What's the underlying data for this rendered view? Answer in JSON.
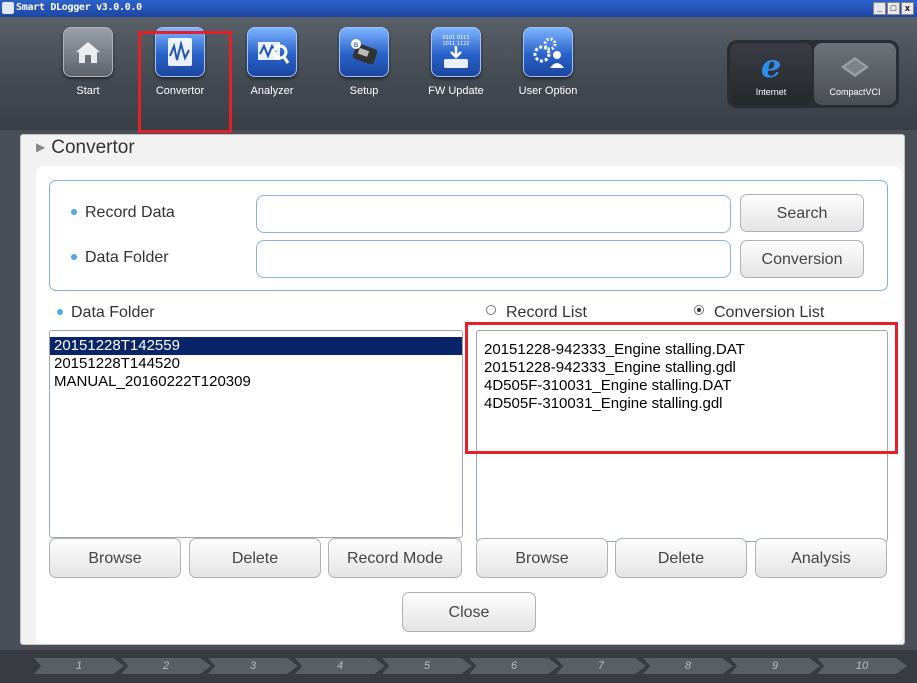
{
  "window": {
    "title": "Smart DLogger v3.0.0.0",
    "minimize": "_",
    "restore": "□",
    "close": "x"
  },
  "toolbar": {
    "items": [
      {
        "label": "Start",
        "icon": "home-icon"
      },
      {
        "label": "Convertor",
        "icon": "waveform-document-icon"
      },
      {
        "label": "Analyzer",
        "icon": "magnifier-waveform-icon"
      },
      {
        "label": "Setup",
        "icon": "bluetooth-device-icon"
      },
      {
        "label": "FW Update",
        "icon": "firmware-chip-icon"
      },
      {
        "label": "User Option",
        "icon": "gears-user-icon"
      }
    ],
    "fw_chip_text": "0101 0111\n1011 1122",
    "right": [
      {
        "label": "Internet",
        "icon": "internet-explorer-icon"
      },
      {
        "label": "CompactVCI",
        "icon": "vci-device-icon"
      }
    ],
    "highlight_color": "#e4212a"
  },
  "page": {
    "title": "Convertor"
  },
  "form": {
    "record_data_label": "Record Data",
    "record_data_value": "",
    "data_folder_label": "Data Folder",
    "data_folder_value": "",
    "search_button": "Search",
    "conversion_button": "Conversion"
  },
  "left_list": {
    "header": "Data Folder",
    "items": [
      "20151228T142559",
      "20151228T144520",
      "MANUAL_20160222T120309"
    ],
    "selected_index": 0
  },
  "right_list": {
    "radio_record": "Record List",
    "radio_conversion": "Conversion List",
    "selected_radio": "Conversion List",
    "items": [
      "20151228-942333_Engine stalling.DAT",
      "20151228-942333_Engine stalling.gdl",
      "4D505F-310031_Engine stalling.DAT",
      "4D505F-310031_Engine stalling.gdl"
    ]
  },
  "buttons": {
    "left_browse": "Browse",
    "left_delete": "Delete",
    "record_mode": "Record Mode",
    "right_browse": "Browse",
    "right_delete": "Delete",
    "analysis": "Analysis",
    "close": "Close"
  },
  "steps": [
    "1",
    "2",
    "3",
    "4",
    "5",
    "6",
    "7",
    "8",
    "9",
    "10"
  ],
  "colors": {
    "accent": "#4ea7e8",
    "selection": "#0a246a",
    "highlight": "#e4212a"
  }
}
